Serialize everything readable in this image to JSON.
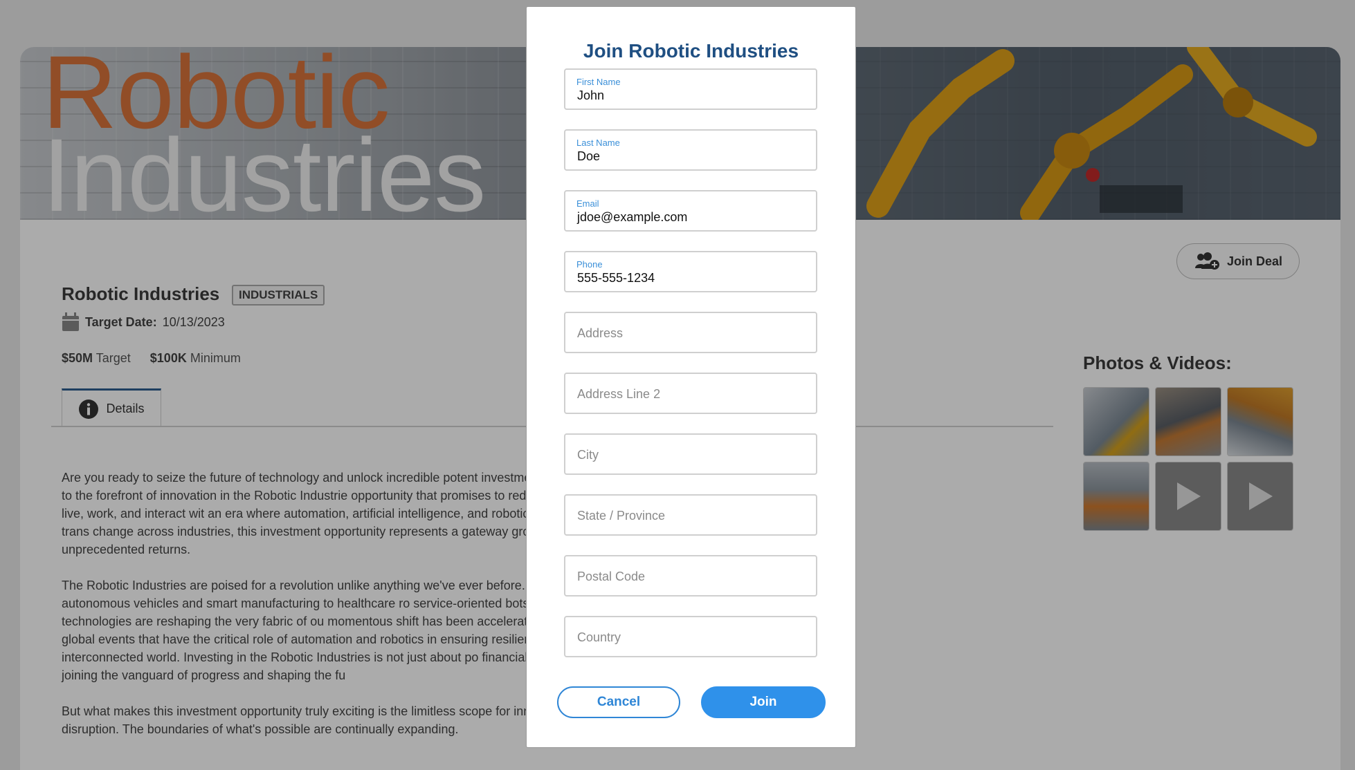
{
  "banner": {
    "title_line1": "Robotic",
    "title_line2": "Industries",
    "accent_color": "#d9743b"
  },
  "deal": {
    "join_label": "Join Deal",
    "join_icon": "user-plus-icon",
    "company_name": "Robotic Industries",
    "sector": "INDUSTRIALS",
    "target_date_label": "Target Date:",
    "target_date_value": "10/13/2023",
    "target_amount": "$50M",
    "target_label": "Target",
    "minimum_amount": "$100K",
    "minimum_label": "Minimum"
  },
  "tabs": [
    {
      "label": "Details",
      "icon": "info-icon",
      "active": true
    }
  ],
  "description": [
    "Are you ready to seize the future of technology and unlock incredible potent investments? Welcome to the forefront of innovation in the Robotic Industrie opportunity that promises to redefine the way we live, work, and interact wit an era where automation, artificial intelligence, and robotics are driving trans change across industries, this investment opportunity represents a gateway growth and unprecedented returns.",
    "The Robotic Industries are poised for a revolution unlike anything we've ever before. From autonomous vehicles and smart manufacturing to healthcare ro service-oriented bots, these technologies are reshaping the very fabric of ou momentous shift has been accelerated by the recent global events that have the critical role of automation and robotics in ensuring resilience and efficier interconnected world. Investing in the Robotic Industries is not just about po financial gains; it's about joining the vanguard of progress and shaping the fu",
    "But what makes this investment opportunity truly exciting is the limitless scope for innovation and disruption. The boundaries of what's possible are continually expanding."
  ],
  "media": {
    "title": "Photos & Videos:",
    "items": [
      {
        "type": "photo"
      },
      {
        "type": "photo"
      },
      {
        "type": "photo"
      },
      {
        "type": "photo"
      },
      {
        "type": "video",
        "icon": "play-icon"
      },
      {
        "type": "video",
        "icon": "play-icon"
      }
    ]
  },
  "modal": {
    "title": "Join Robotic Industries",
    "fields": [
      {
        "label": "First Name",
        "value": "John",
        "placeholder": ""
      },
      {
        "label": "Last Name",
        "value": "Doe",
        "placeholder": ""
      },
      {
        "label": "Email",
        "value": "jdoe@example.com",
        "placeholder": ""
      },
      {
        "label": "Phone",
        "value": "555-555-1234",
        "placeholder": ""
      },
      {
        "label": "",
        "value": "",
        "placeholder": "Address"
      },
      {
        "label": "",
        "value": "",
        "placeholder": "Address Line 2"
      },
      {
        "label": "",
        "value": "",
        "placeholder": "City"
      },
      {
        "label": "",
        "value": "",
        "placeholder": "State / Province"
      },
      {
        "label": "",
        "value": "",
        "placeholder": "Postal Code"
      },
      {
        "label": "",
        "value": "",
        "placeholder": "Country"
      }
    ],
    "cancel_label": "Cancel",
    "join_label": "Join",
    "primary_color": "#2f91ea"
  }
}
